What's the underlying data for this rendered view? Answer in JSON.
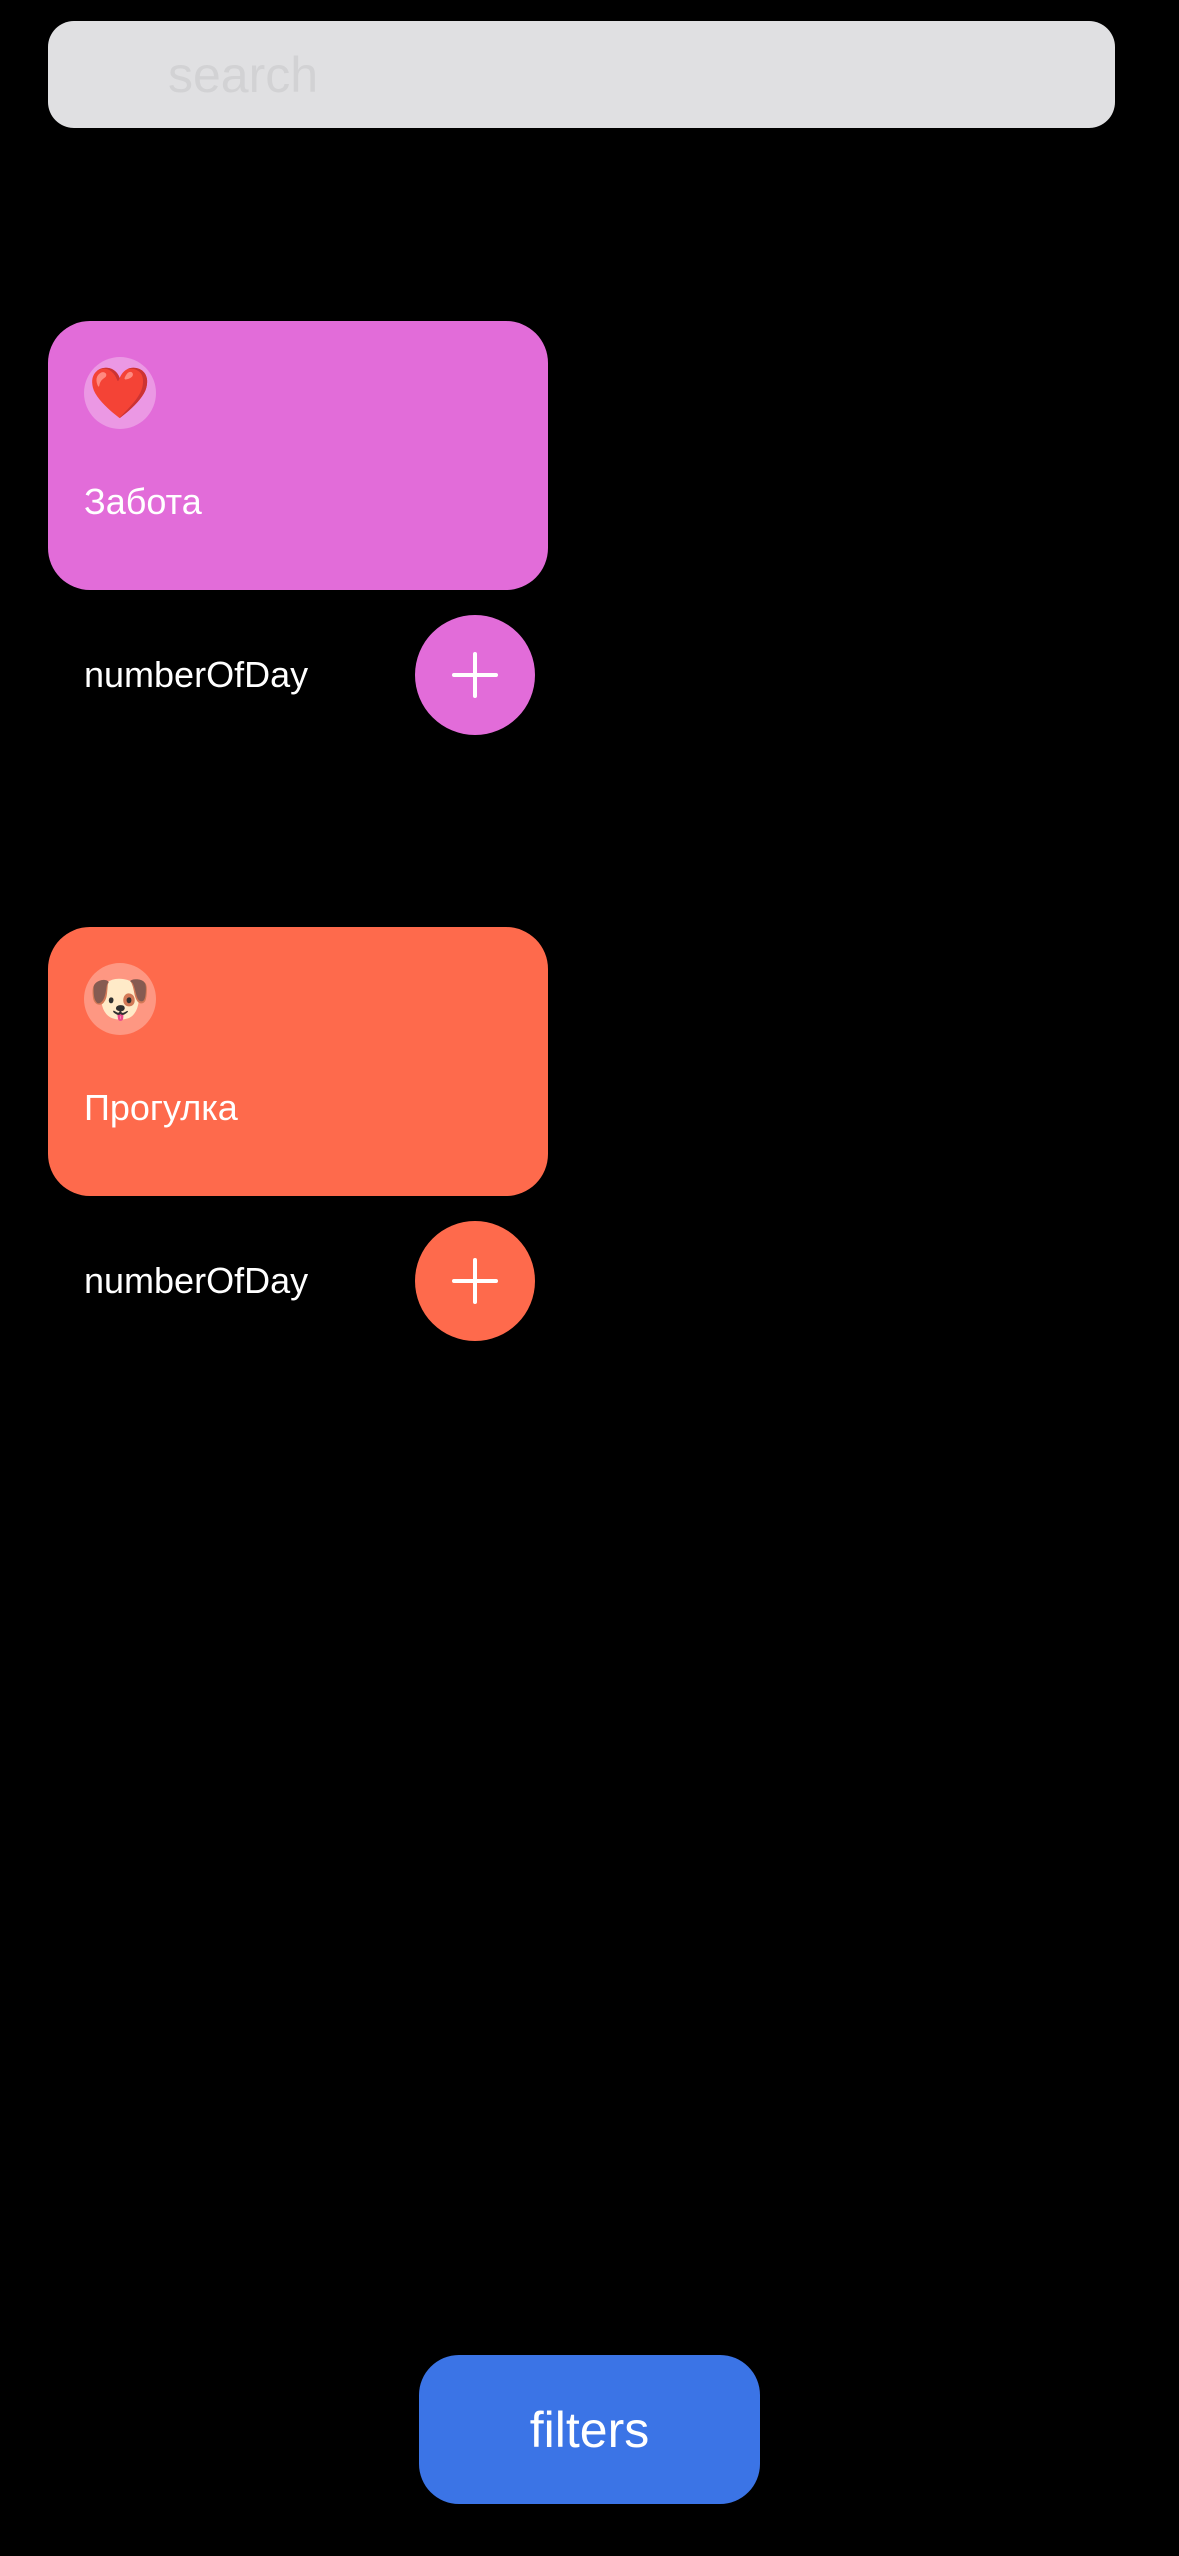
{
  "search": {
    "placeholder": "search",
    "value": ""
  },
  "habits": [
    {
      "title": "Забота",
      "emoji": "❤️",
      "icon_name": "heart-emoji-icon",
      "count_label": "numberOfDay",
      "color": "#e26cd9"
    },
    {
      "title": "Прогулка",
      "emoji": "🐶",
      "icon_name": "dog-face-emoji-icon",
      "count_label": "numberOfDay",
      "color": "#fe6a4c"
    }
  ],
  "add_button_icon": "plus-icon",
  "filters": {
    "label": "filters",
    "color": "#3b74e6"
  }
}
